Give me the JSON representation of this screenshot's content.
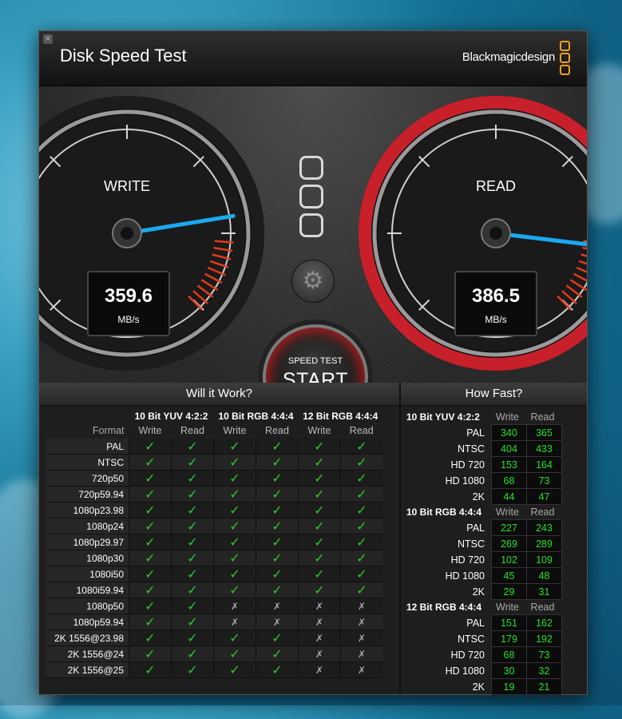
{
  "window": {
    "title": "Disk Speed Test",
    "brand": "Blackmagicdesign",
    "close_label": "×"
  },
  "gauges": {
    "write": {
      "label": "WRITE",
      "value": "359.6",
      "unit": "MB/s",
      "reading": 359.6
    },
    "read": {
      "label": "READ",
      "value": "386.5",
      "unit": "MB/s",
      "reading": 386.5
    }
  },
  "start_button": {
    "small": "SPEED TEST",
    "big": "START"
  },
  "settings_icon": "gear-icon",
  "will_it_work": {
    "heading": "Will it Work?",
    "format_label": "Format",
    "groups": [
      "10 Bit YUV 4:2:2",
      "10 Bit RGB 4:4:4",
      "12 Bit RGB 4:4:4"
    ],
    "sub_cols": [
      "Write",
      "Read",
      "Write",
      "Read",
      "Write",
      "Read"
    ],
    "rows": [
      {
        "format": "PAL",
        "cells": [
          "✓",
          "✓",
          "✓",
          "✓",
          "✓",
          "✓"
        ]
      },
      {
        "format": "NTSC",
        "cells": [
          "✓",
          "✓",
          "✓",
          "✓",
          "✓",
          "✓"
        ]
      },
      {
        "format": "720p50",
        "cells": [
          "✓",
          "✓",
          "✓",
          "✓",
          "✓",
          "✓"
        ]
      },
      {
        "format": "720p59.94",
        "cells": [
          "✓",
          "✓",
          "✓",
          "✓",
          "✓",
          "✓"
        ]
      },
      {
        "format": "1080p23.98",
        "cells": [
          "✓",
          "✓",
          "✓",
          "✓",
          "✓",
          "✓"
        ]
      },
      {
        "format": "1080p24",
        "cells": [
          "✓",
          "✓",
          "✓",
          "✓",
          "✓",
          "✓"
        ]
      },
      {
        "format": "1080p29.97",
        "cells": [
          "✓",
          "✓",
          "✓",
          "✓",
          "✓",
          "✓"
        ]
      },
      {
        "format": "1080p30",
        "cells": [
          "✓",
          "✓",
          "✓",
          "✓",
          "✓",
          "✓"
        ]
      },
      {
        "format": "1080i50",
        "cells": [
          "✓",
          "✓",
          "✓",
          "✓",
          "✓",
          "✓"
        ]
      },
      {
        "format": "1080i59.94",
        "cells": [
          "✓",
          "✓",
          "✓",
          "✓",
          "✓",
          "✓"
        ]
      },
      {
        "format": "1080p50",
        "cells": [
          "✓",
          "✓",
          "✗",
          "✗",
          "✗",
          "✗"
        ]
      },
      {
        "format": "1080p59.94",
        "cells": [
          "✓",
          "✓",
          "✗",
          "✗",
          "✗",
          "✗"
        ]
      },
      {
        "format": "2K 1556@23.98",
        "cells": [
          "✓",
          "✓",
          "✓",
          "✓",
          "✗",
          "✗"
        ]
      },
      {
        "format": "2K 1556@24",
        "cells": [
          "✓",
          "✓",
          "✓",
          "✓",
          "✗",
          "✗"
        ]
      },
      {
        "format": "2K 1556@25",
        "cells": [
          "✓",
          "✓",
          "✓",
          "✓",
          "✗",
          "✗"
        ]
      }
    ]
  },
  "how_fast": {
    "heading": "How Fast?",
    "sections": [
      {
        "title": "10 Bit YUV 4:2:2",
        "write_label": "Write",
        "read_label": "Read",
        "rows": [
          {
            "label": "PAL",
            "write": "340",
            "read": "365"
          },
          {
            "label": "NTSC",
            "write": "404",
            "read": "433"
          },
          {
            "label": "HD 720",
            "write": "153",
            "read": "164"
          },
          {
            "label": "HD 1080",
            "write": "68",
            "read": "73"
          },
          {
            "label": "2K",
            "write": "44",
            "read": "47"
          }
        ]
      },
      {
        "title": "10 Bit RGB 4:4:4",
        "write_label": "Write",
        "read_label": "Read",
        "rows": [
          {
            "label": "PAL",
            "write": "227",
            "read": "243"
          },
          {
            "label": "NTSC",
            "write": "269",
            "read": "289"
          },
          {
            "label": "HD 720",
            "write": "102",
            "read": "109"
          },
          {
            "label": "HD 1080",
            "write": "45",
            "read": "48"
          },
          {
            "label": "2K",
            "write": "29",
            "read": "31"
          }
        ]
      },
      {
        "title": "12 Bit RGB 4:4:4",
        "write_label": "Write",
        "read_label": "Read",
        "rows": [
          {
            "label": "PAL",
            "write": "151",
            "read": "162"
          },
          {
            "label": "NTSC",
            "write": "179",
            "read": "192"
          },
          {
            "label": "HD 720",
            "write": "68",
            "read": "73"
          },
          {
            "label": "HD 1080",
            "write": "30",
            "read": "32"
          },
          {
            "label": "2K",
            "write": "19",
            "read": "21"
          }
        ]
      }
    ]
  },
  "colors": {
    "check": "#2ec92e",
    "speed_digits": "#23e023",
    "needle": "#1aa9f0",
    "read_ring": "#c8202a",
    "accent_logo": "#f0a020"
  }
}
